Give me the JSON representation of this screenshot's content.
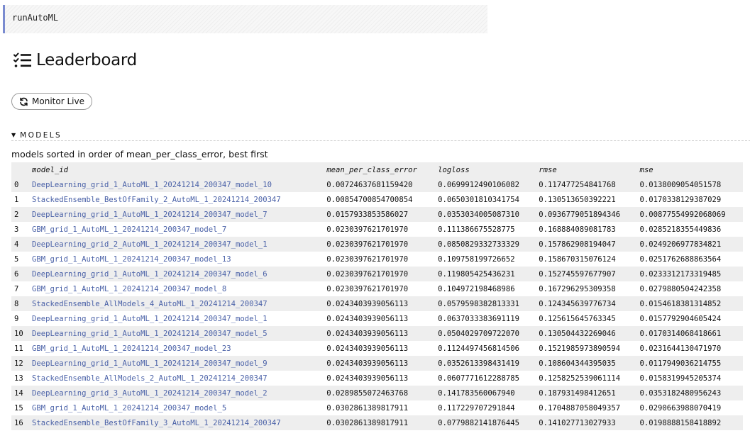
{
  "code_cell": {
    "text": "runAutoML"
  },
  "heading": {
    "title": "Leaderboard",
    "icon": "list-check-icon"
  },
  "monitor_button": {
    "label": "Monitor Live",
    "icon": "refresh-icon"
  },
  "section": {
    "title": "MODELS",
    "caption": "models sorted in order of mean_per_class_error, best first"
  },
  "table": {
    "columns": [
      "",
      "model_id",
      "mean_per_class_error",
      "logloss",
      "rmse",
      "mse"
    ],
    "rows": [
      [
        "0",
        "DeepLearning_grid_1_AutoML_1_20241214_200347_model_10",
        "0.00724637681159420",
        "0.0699912490106082",
        "0.117477254841768",
        "0.0138009054051578"
      ],
      [
        "1",
        "StackedEnsemble_BestOfFamily_2_AutoML_1_20241214_200347",
        "0.00854700854700854",
        "0.0650301810341754",
        "0.130513650392221",
        "0.0170338129387029"
      ],
      [
        "2",
        "DeepLearning_grid_1_AutoML_1_20241214_200347_model_7",
        "0.0157933853586027",
        "0.0353034005087310",
        "0.0936779051894346",
        "0.00877554992068069"
      ],
      [
        "3",
        "GBM_grid_1_AutoML_1_20241214_200347_model_7",
        "0.0230397621701970",
        "0.111386675528775",
        "0.168884089081783",
        "0.0285218355449836"
      ],
      [
        "4",
        "DeepLearning_grid_2_AutoML_1_20241214_200347_model_1",
        "0.0230397621701970",
        "0.0850829332733329",
        "0.157862908194047",
        "0.0249206977834821"
      ],
      [
        "5",
        "GBM_grid_1_AutoML_1_20241214_200347_model_13",
        "0.0230397621701970",
        "0.109758199726652",
        "0.158670315076124",
        "0.0251762688863564"
      ],
      [
        "6",
        "DeepLearning_grid_1_AutoML_1_20241214_200347_model_6",
        "0.0230397621701970",
        "0.119805425436231",
        "0.152745597677907",
        "0.0233312173319485"
      ],
      [
        "7",
        "GBM_grid_1_AutoML_1_20241214_200347_model_8",
        "0.0230397621701970",
        "0.104972198468986",
        "0.167296295309358",
        "0.0279880504242358"
      ],
      [
        "8",
        "StackedEnsemble_AllModels_4_AutoML_1_20241214_200347",
        "0.0243403939056113",
        "0.0579598382813331",
        "0.124345639776734",
        "0.0154618381314852"
      ],
      [
        "9",
        "DeepLearning_grid_1_AutoML_1_20241214_200347_model_1",
        "0.0243403939056113",
        "0.0637033383691119",
        "0.125615645763345",
        "0.0157792904605424"
      ],
      [
        "10",
        "DeepLearning_grid_1_AutoML_1_20241214_200347_model_5",
        "0.0243403939056113",
        "0.0504029709722070",
        "0.130504432269046",
        "0.0170314068418661"
      ],
      [
        "11",
        "GBM_grid_1_AutoML_1_20241214_200347_model_23",
        "0.0243403939056113",
        "0.1124497456814506",
        "0.1521985973890594",
        "0.0231644130471970"
      ],
      [
        "12",
        "DeepLearning_grid_1_AutoML_1_20241214_200347_model_9",
        "0.0243403939056113",
        "0.0352613398431419",
        "0.108604344395035",
        "0.0117949036214755"
      ],
      [
        "13",
        "StackedEnsemble_AllModels_2_AutoML_1_20241214_200347",
        "0.0243403939056113",
        "0.0607771612288785",
        "0.1258252539061114",
        "0.0158319945205374"
      ],
      [
        "14",
        "DeepLearning_grid_3_AutoML_1_20241214_200347_model_2",
        "0.0289855072463768",
        "0.141783560067940",
        "0.187931498412651",
        "0.0353182480956243"
      ],
      [
        "15",
        "GBM_grid_1_AutoML_1_20241214_200347_model_5",
        "0.0302861389817911",
        "0.117229707291844",
        "0.1704887058049357",
        "0.0290663988070419"
      ],
      [
        "16",
        "StackedEnsemble_BestOfFamily_3_AutoML_1_20241214_200347",
        "0.0302861389817911",
        "0.0779882141876445",
        "0.141027713027933",
        "0.0198888158418892"
      ]
    ]
  },
  "colors": {
    "link": "#4b62a8",
    "cell_border": "#7a8bd0",
    "row_stripe": "#eeeeee"
  }
}
